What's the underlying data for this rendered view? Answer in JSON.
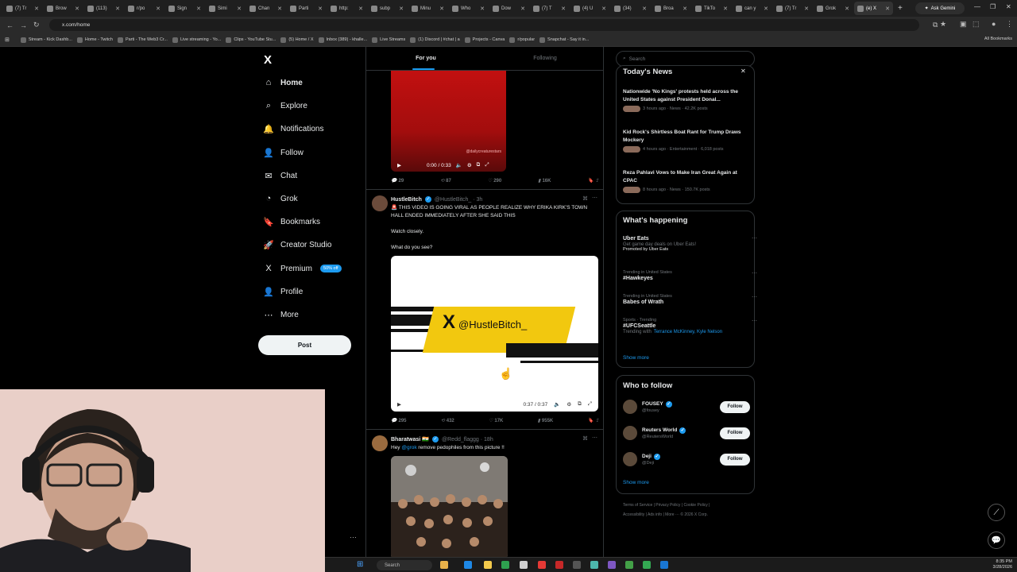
{
  "browser": {
    "tabs": [
      {
        "label": "(7) Tr"
      },
      {
        "label": "Brow"
      },
      {
        "label": "(113)"
      },
      {
        "label": "r/po"
      },
      {
        "label": "Sign"
      },
      {
        "label": "Simi"
      },
      {
        "label": "Chan"
      },
      {
        "label": "Parti"
      },
      {
        "label": "http:"
      },
      {
        "label": "subp"
      },
      {
        "label": "Minu"
      },
      {
        "label": "Who"
      },
      {
        "label": "Dow"
      },
      {
        "label": "(7) T"
      },
      {
        "label": "(4) U"
      },
      {
        "label": "(34)"
      },
      {
        "label": "Broa"
      },
      {
        "label": "TikTo"
      },
      {
        "label": "can y"
      },
      {
        "label": "(7) Tr"
      },
      {
        "label": "Grok"
      },
      {
        "label": "(e) X"
      }
    ],
    "ask_gemini": "Ask Gemini",
    "url": "x.com/home",
    "bookmarks": [
      "Stream - Kick Dashb...",
      "Home - Twitch",
      "Parti - The Web3 Cr...",
      "Live streaming - Yo...",
      "Clips - YouTube Stu...",
      "(5) Home / X",
      "Inbox (389) - khalle...",
      "Live Streams",
      "(1) Discord | #chat | a",
      "Projects - Canva",
      "r/popular",
      "Snapchat - Say it in..."
    ],
    "all_bookmarks": "All Bookmarks"
  },
  "sidebar": {
    "logo": "X",
    "items": [
      {
        "label": "Home",
        "icon": "⌂"
      },
      {
        "label": "Explore",
        "icon": "⌕"
      },
      {
        "label": "Notifications",
        "icon": "🔔"
      },
      {
        "label": "Follow",
        "icon": "👤"
      },
      {
        "label": "Chat",
        "icon": "✉"
      },
      {
        "label": "Grok",
        "icon": "◔"
      },
      {
        "label": "Bookmarks",
        "icon": "🔖"
      },
      {
        "label": "Creator Studio",
        "icon": "🚀"
      },
      {
        "label": "Premium",
        "icon": "X"
      },
      {
        "label": "Profile",
        "icon": "👤"
      },
      {
        "label": "More",
        "icon": "⋯"
      }
    ],
    "premium_badge": "50% off",
    "post_button": "Post"
  },
  "feed": {
    "tabs": [
      "For you",
      "Following"
    ],
    "video1": {
      "watermark": "@dailycreaturestars",
      "time": "0:00 / 0:33",
      "stats": {
        "replies": "29",
        "reposts": "87",
        "likes": "290",
        "views": "16K"
      }
    },
    "tweet2": {
      "name": "HustleBitch",
      "handle": "@HustleBitch_ · 3h",
      "text": "🚨 THIS VIDEO IS GOING VIRAL AS PEOPLE REALIZE WHY ERIKA KIRK'S TOWN HALL ENDED IMMEDIATELY AFTER SHE SAID THIS",
      "line2": "Watch closely.",
      "line3": "What do you see?",
      "video_handle": "@HustleBitch_",
      "video_logo": "X",
      "time": "0:37 / 0:37",
      "stats": {
        "replies": "295",
        "reposts": "432",
        "likes": "17K",
        "views": "955K"
      }
    },
    "tweet3": {
      "name": "Bharatwasi 🇮🇳",
      "handle": "@Redd_flaggg · 18h",
      "text_pre": "Hey ",
      "mention": "@grok",
      "text_post": " remove pedophiles from this picture !!"
    }
  },
  "right": {
    "search_placeholder": "Search",
    "news_title": "Today's News",
    "news": [
      {
        "headline": "Nationwide 'No Kings' protests held across the United States against President Donal...",
        "meta": "3 hours ago · News · 42.2K posts"
      },
      {
        "headline": "Kid Rock's Shirtless Boat Rant for Trump Draws Mockery",
        "meta": "4 hours ago · Entertainment · 6,018 posts"
      },
      {
        "headline": "Reza Pahlavi Vows to Make Iran Great Again at CPAC",
        "meta": "8 hours ago · News · 150.7K posts"
      }
    ],
    "happening_title": "What's happening",
    "trends": [
      {
        "ctx": "",
        "title": "Uber Eats",
        "sub": "Get game day deals on Uber Eats!",
        "promo": "Promoted by Uber Eats"
      },
      {
        "ctx": "Trending in United States",
        "title": "#Hawkeyes",
        "sub": "",
        "promo": ""
      },
      {
        "ctx": "Trending in United States",
        "title": "Babes of Wrath",
        "sub": "",
        "promo": ""
      },
      {
        "ctx": "Sports · Trending",
        "title": "#UFCSeattle",
        "sub": "Trending with",
        "promo": "Terrance McKinney, Kyle Nelson"
      }
    ],
    "show_more": "Show more",
    "wtf_title": "Who to follow",
    "follow_label": "Follow",
    "follows": [
      {
        "name": "FOUSEY",
        "handle": "@fousey"
      },
      {
        "name": "Reuters World",
        "handle": "@ReutersWorld"
      },
      {
        "name": "Deji",
        "handle": "@Deji"
      }
    ],
    "footer1": "Terms of Service  |  Privacy Policy  |  Cookie Policy  |",
    "footer2": "Accessibility  |  Ads info  |  More ···  © 2026 X Corp."
  },
  "taskbar": {
    "search": "Search",
    "time": "8:35 PM",
    "date": "3/28/2026"
  }
}
